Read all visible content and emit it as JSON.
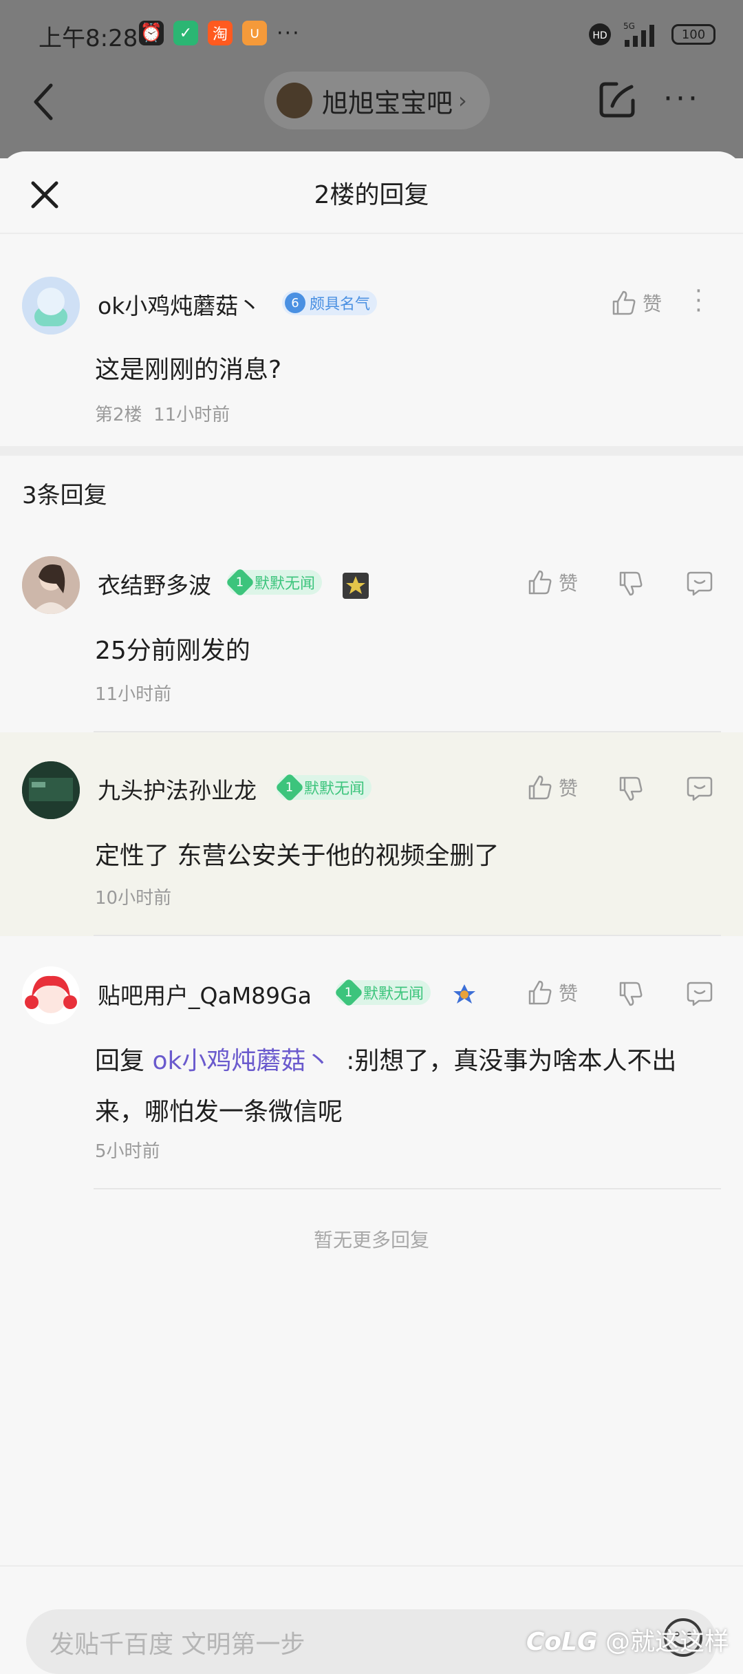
{
  "status_bar": {
    "time": "上午8:28",
    "network": "5G",
    "battery": "100",
    "hd_label": "HD"
  },
  "nav": {
    "forum_name": "旭旭宝宝吧"
  },
  "sheet": {
    "title": "2楼的回复"
  },
  "post": {
    "username": "ok小鸡炖蘑菇丶",
    "level": "6",
    "level_title": "颇具名气",
    "content": "这是刚刚的消息?",
    "floor": "第2楼",
    "time": "11小时前",
    "like_label": "赞"
  },
  "replies_count": "3条回复",
  "replies": [
    {
      "username": "衣结野多波",
      "level": "1",
      "level_title": "默默无闻",
      "content": "25分前刚发的",
      "time": "11小时前",
      "like_label": "赞"
    },
    {
      "username": "九头护法孙业龙",
      "level": "1",
      "level_title": "默默无闻",
      "content": "定性了 东营公安关于他的视频全删了",
      "time": "10小时前",
      "like_label": "赞"
    },
    {
      "username": "贴吧用户_QaM89Ga",
      "level": "1",
      "level_title": "默默无闻",
      "reply_prefix": "回复",
      "reply_to": "ok小鸡炖蘑菇丶",
      "content_line1": ":别想了，真没事为啥本人不出",
      "content_line2": "来，哪怕发一条微信呢",
      "time": "5小时前",
      "like_label": "赞"
    }
  ],
  "no_more": "暂无更多回复",
  "input": {
    "placeholder": "发贴千百度 文明第一步"
  },
  "watermark": "@就这这样",
  "colors": {
    "link": "#6a5acd",
    "badge_blue": "#4a90e2",
    "badge_green": "#3cc47c"
  }
}
